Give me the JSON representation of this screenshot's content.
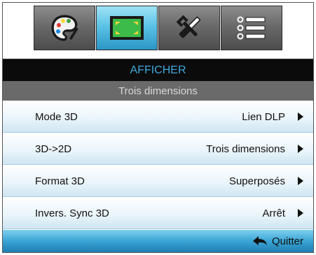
{
  "tabs": [
    {
      "icon": "palette-icon",
      "active": false
    },
    {
      "icon": "display-screen-icon",
      "active": true
    },
    {
      "icon": "wrench-screwdriver-icon",
      "active": false
    },
    {
      "icon": "list-icon",
      "active": false
    }
  ],
  "header": {
    "title": "AFFICHER",
    "subtitle": "Trois dimensions"
  },
  "rows": [
    {
      "label": "Mode 3D",
      "value": "Lien DLP"
    },
    {
      "label": "3D->2D",
      "value": "Trois dimensions"
    },
    {
      "label": "Format 3D",
      "value": "Superposés"
    },
    {
      "label": "Invers. Sync 3D",
      "value": "Arrêt"
    }
  ],
  "footer": {
    "exit_label": "Quitter",
    "exit_icon": "back-arrow-icon"
  },
  "colors": {
    "accent": "#3fa9dc",
    "active_tab": "#5cc3e6",
    "title_bar": "#0b0b0b",
    "subtitle_bar": "#6a6a6a"
  }
}
